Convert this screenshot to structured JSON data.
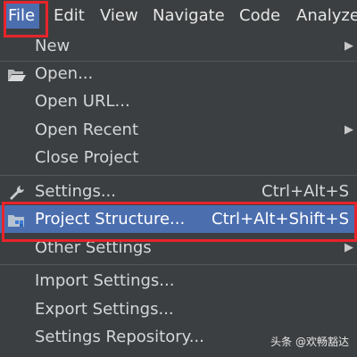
{
  "menubar": {
    "items": [
      {
        "label": "File",
        "active": true
      },
      {
        "label": "Edit",
        "active": false
      },
      {
        "label": "View",
        "active": false
      },
      {
        "label": "Navigate",
        "active": false
      },
      {
        "label": "Code",
        "active": false
      },
      {
        "label": "Analyze",
        "active": false
      }
    ]
  },
  "file_menu": {
    "items": [
      {
        "label": "New",
        "submenu": true
      },
      {
        "label": "Open...",
        "icon": "folder-open-icon"
      },
      {
        "label": "Open URL..."
      },
      {
        "label": "Open Recent",
        "submenu": true
      },
      {
        "label": "Close Project"
      },
      {
        "label": "Settings...",
        "shortcut": "Ctrl+Alt+S",
        "icon": "wrench-icon"
      },
      {
        "label": "Project Structure...",
        "shortcut": "Ctrl+Alt+Shift+S",
        "icon": "project-structure-icon",
        "selected": true
      },
      {
        "label": "Other Settings",
        "submenu": true
      },
      {
        "label": "Import Settings..."
      },
      {
        "label": "Export Settings..."
      },
      {
        "label": "Settings Repository..."
      }
    ]
  },
  "watermark": "头条 @欢畅豁达",
  "colors": {
    "background": "#3c3f41",
    "selection": "#4b6eaf",
    "highlight_frame": "#e8242b",
    "text": "#d4d6d8"
  }
}
